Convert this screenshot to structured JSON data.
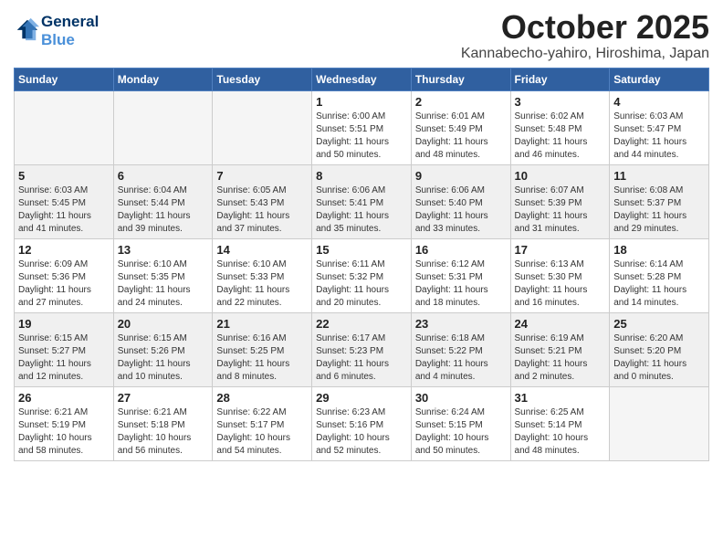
{
  "header": {
    "logo_line1": "General",
    "logo_line2": "Blue",
    "month": "October 2025",
    "location": "Kannabecho-yahiro, Hiroshima, Japan"
  },
  "weekdays": [
    "Sunday",
    "Monday",
    "Tuesday",
    "Wednesday",
    "Thursday",
    "Friday",
    "Saturday"
  ],
  "weeks": [
    [
      {
        "day": "",
        "info": ""
      },
      {
        "day": "",
        "info": ""
      },
      {
        "day": "",
        "info": ""
      },
      {
        "day": "1",
        "info": "Sunrise: 6:00 AM\nSunset: 5:51 PM\nDaylight: 11 hours\nand 50 minutes."
      },
      {
        "day": "2",
        "info": "Sunrise: 6:01 AM\nSunset: 5:49 PM\nDaylight: 11 hours\nand 48 minutes."
      },
      {
        "day": "3",
        "info": "Sunrise: 6:02 AM\nSunset: 5:48 PM\nDaylight: 11 hours\nand 46 minutes."
      },
      {
        "day": "4",
        "info": "Sunrise: 6:03 AM\nSunset: 5:47 PM\nDaylight: 11 hours\nand 44 minutes."
      }
    ],
    [
      {
        "day": "5",
        "info": "Sunrise: 6:03 AM\nSunset: 5:45 PM\nDaylight: 11 hours\nand 41 minutes."
      },
      {
        "day": "6",
        "info": "Sunrise: 6:04 AM\nSunset: 5:44 PM\nDaylight: 11 hours\nand 39 minutes."
      },
      {
        "day": "7",
        "info": "Sunrise: 6:05 AM\nSunset: 5:43 PM\nDaylight: 11 hours\nand 37 minutes."
      },
      {
        "day": "8",
        "info": "Sunrise: 6:06 AM\nSunset: 5:41 PM\nDaylight: 11 hours\nand 35 minutes."
      },
      {
        "day": "9",
        "info": "Sunrise: 6:06 AM\nSunset: 5:40 PM\nDaylight: 11 hours\nand 33 minutes."
      },
      {
        "day": "10",
        "info": "Sunrise: 6:07 AM\nSunset: 5:39 PM\nDaylight: 11 hours\nand 31 minutes."
      },
      {
        "day": "11",
        "info": "Sunrise: 6:08 AM\nSunset: 5:37 PM\nDaylight: 11 hours\nand 29 minutes."
      }
    ],
    [
      {
        "day": "12",
        "info": "Sunrise: 6:09 AM\nSunset: 5:36 PM\nDaylight: 11 hours\nand 27 minutes."
      },
      {
        "day": "13",
        "info": "Sunrise: 6:10 AM\nSunset: 5:35 PM\nDaylight: 11 hours\nand 24 minutes."
      },
      {
        "day": "14",
        "info": "Sunrise: 6:10 AM\nSunset: 5:33 PM\nDaylight: 11 hours\nand 22 minutes."
      },
      {
        "day": "15",
        "info": "Sunrise: 6:11 AM\nSunset: 5:32 PM\nDaylight: 11 hours\nand 20 minutes."
      },
      {
        "day": "16",
        "info": "Sunrise: 6:12 AM\nSunset: 5:31 PM\nDaylight: 11 hours\nand 18 minutes."
      },
      {
        "day": "17",
        "info": "Sunrise: 6:13 AM\nSunset: 5:30 PM\nDaylight: 11 hours\nand 16 minutes."
      },
      {
        "day": "18",
        "info": "Sunrise: 6:14 AM\nSunset: 5:28 PM\nDaylight: 11 hours\nand 14 minutes."
      }
    ],
    [
      {
        "day": "19",
        "info": "Sunrise: 6:15 AM\nSunset: 5:27 PM\nDaylight: 11 hours\nand 12 minutes."
      },
      {
        "day": "20",
        "info": "Sunrise: 6:15 AM\nSunset: 5:26 PM\nDaylight: 11 hours\nand 10 minutes."
      },
      {
        "day": "21",
        "info": "Sunrise: 6:16 AM\nSunset: 5:25 PM\nDaylight: 11 hours\nand 8 minutes."
      },
      {
        "day": "22",
        "info": "Sunrise: 6:17 AM\nSunset: 5:23 PM\nDaylight: 11 hours\nand 6 minutes."
      },
      {
        "day": "23",
        "info": "Sunrise: 6:18 AM\nSunset: 5:22 PM\nDaylight: 11 hours\nand 4 minutes."
      },
      {
        "day": "24",
        "info": "Sunrise: 6:19 AM\nSunset: 5:21 PM\nDaylight: 11 hours\nand 2 minutes."
      },
      {
        "day": "25",
        "info": "Sunrise: 6:20 AM\nSunset: 5:20 PM\nDaylight: 11 hours\nand 0 minutes."
      }
    ],
    [
      {
        "day": "26",
        "info": "Sunrise: 6:21 AM\nSunset: 5:19 PM\nDaylight: 10 hours\nand 58 minutes."
      },
      {
        "day": "27",
        "info": "Sunrise: 6:21 AM\nSunset: 5:18 PM\nDaylight: 10 hours\nand 56 minutes."
      },
      {
        "day": "28",
        "info": "Sunrise: 6:22 AM\nSunset: 5:17 PM\nDaylight: 10 hours\nand 54 minutes."
      },
      {
        "day": "29",
        "info": "Sunrise: 6:23 AM\nSunset: 5:16 PM\nDaylight: 10 hours\nand 52 minutes."
      },
      {
        "day": "30",
        "info": "Sunrise: 6:24 AM\nSunset: 5:15 PM\nDaylight: 10 hours\nand 50 minutes."
      },
      {
        "day": "31",
        "info": "Sunrise: 6:25 AM\nSunset: 5:14 PM\nDaylight: 10 hours\nand 48 minutes."
      },
      {
        "day": "",
        "info": ""
      }
    ]
  ]
}
